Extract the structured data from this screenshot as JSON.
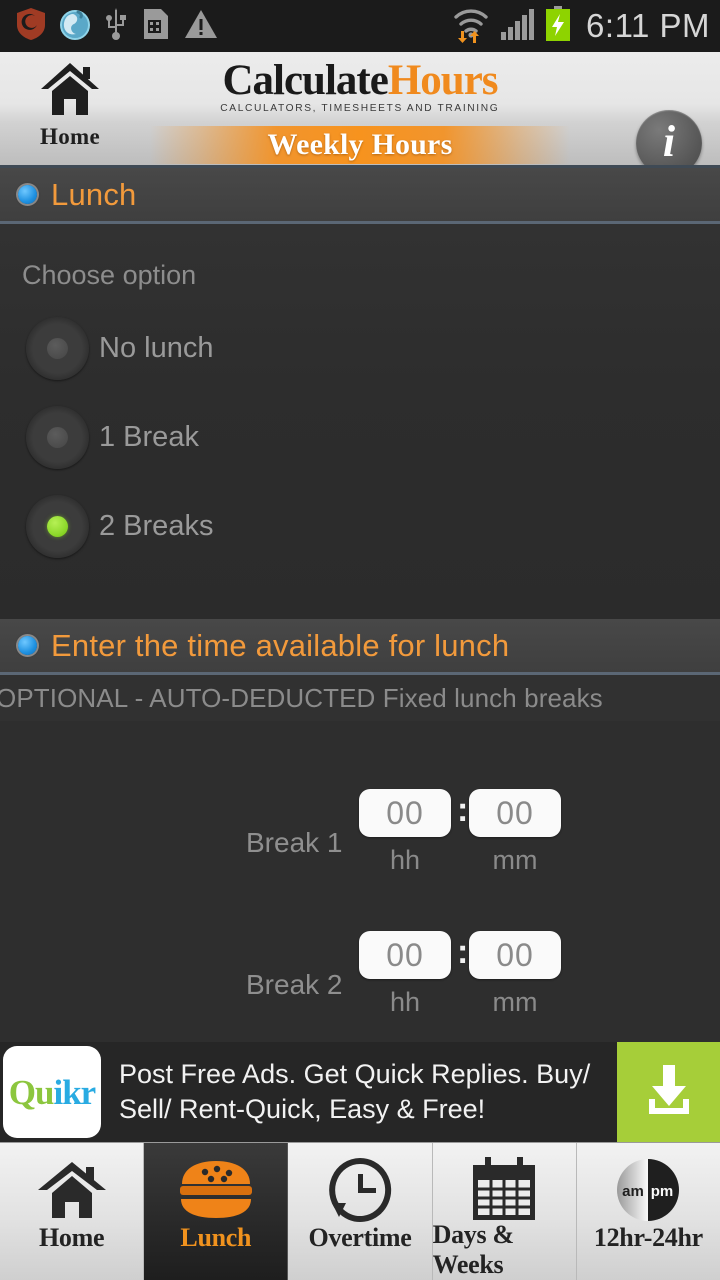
{
  "statusbar": {
    "time": "6:11 PM",
    "left_icons": [
      "shield-icon",
      "globe-icon",
      "usb-icon",
      "sim-card-alert-icon",
      "warning-triangle-icon"
    ],
    "right_icons": [
      "wifi-icon",
      "cellular-signal-icon",
      "battery-charging-icon"
    ]
  },
  "header": {
    "home_label": "Home",
    "logo_part1": "Calculate",
    "logo_part2": "Hours",
    "logo_tagline": "CALCULATORS, TIMESHEETS AND TRAINING",
    "banner_title": "Weekly Hours",
    "info_label": "i"
  },
  "lunch_section": {
    "title": "Lunch",
    "choose_label": "Choose option",
    "options": [
      {
        "label": "No lunch",
        "selected": false
      },
      {
        "label": "1 Break",
        "selected": false
      },
      {
        "label": "2 Breaks",
        "selected": true
      }
    ]
  },
  "time_section": {
    "title": "Enter the time available for lunch",
    "optional_note": "OPTIONAL - AUTO-DEDUCTED Fixed lunch breaks",
    "breaks": [
      {
        "label": "Break 1",
        "hh": "00",
        "mm": "00",
        "hh_unit": "hh",
        "mm_unit": "mm",
        "separator": ":"
      },
      {
        "label": "Break 2",
        "hh": "00",
        "mm": "00",
        "hh_unit": "hh",
        "mm_unit": "mm",
        "separator": ":"
      }
    ]
  },
  "ad": {
    "brand_part1": "Qu",
    "brand_part2": "ikr",
    "text": "Post Free Ads. Get Quick Replies. Buy/ Sell/ Rent-Quick, Easy & Free!",
    "cta_icon": "download-icon"
  },
  "bottom_nav": [
    {
      "label": "Home",
      "icon": "home-icon",
      "active": false
    },
    {
      "label": "Lunch",
      "icon": "burger-icon",
      "active": true
    },
    {
      "label": "Overtime",
      "icon": "clock-arrow-icon",
      "active": false
    },
    {
      "label": "Days & Weeks",
      "icon": "calendar-icon",
      "active": false
    },
    {
      "label": "12hr-24hr",
      "icon": "am-pm-circle-icon",
      "active": false
    }
  ],
  "colors": {
    "accent_orange": "#f0921e",
    "selected_green": "#8ed92c",
    "radio_blue": "#1e90e0",
    "ad_green": "#a6ce39",
    "background": "#2e2e2e"
  }
}
